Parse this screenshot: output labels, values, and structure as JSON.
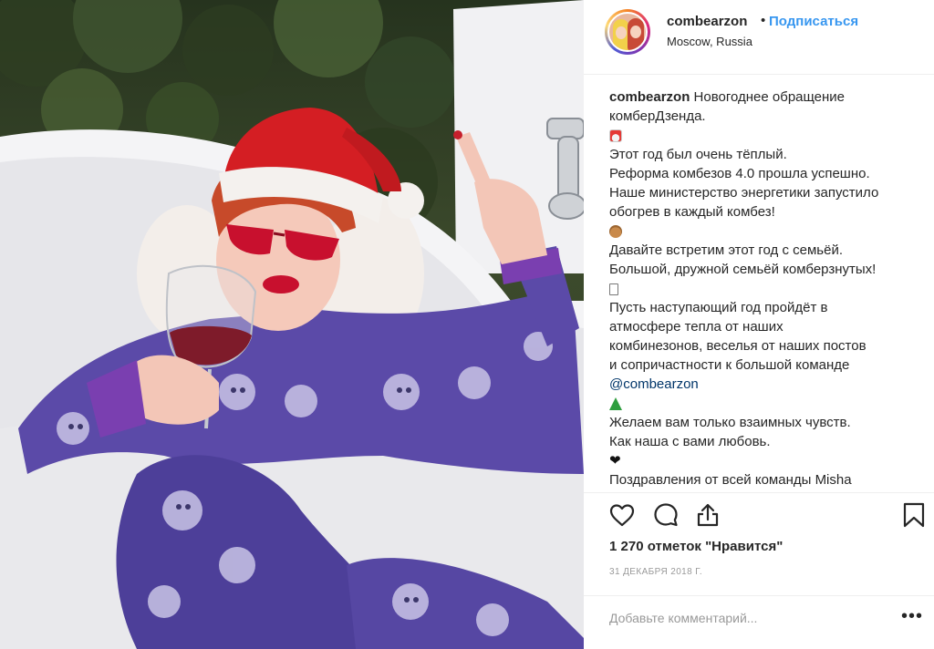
{
  "post": {
    "photo_label": "Post photo"
  },
  "header": {
    "username": "combearzon",
    "separator": "•",
    "follow_label": "Подписаться",
    "location": "Moscow, Russia"
  },
  "caption": {
    "author": "combearzon",
    "first_line_text": " Новогоднее обращение",
    "lines": [
      "комберДзенда.",
      "",
      "Этот год был очень тёплый.",
      "Реформа комбезов 4.0 прошла успешно.",
      "Наше министерство энергетики запустило",
      "обогрев в каждый комбез!",
      "",
      "Давайте встретим этот год с семьёй.",
      "Большой, дружной семьёй комберзнутых!",
      "",
      "Пусть наступающий год пройдёт в",
      "атмосфере тепла от наших",
      "комбинезонов, веселья от наших постов",
      "и сопричастности к большой команде",
      "@combearzon",
      "",
      "Желаем вам только взаимных чувств.",
      "Как наша с вами любовь.",
      "",
      "Поздравления от всей команды Misha"
    ],
    "emojis": {
      "e1": "santa-emoji",
      "e2": "bear-emoji",
      "e3": "unknown-glyph",
      "e4": "christmas-tree-emoji",
      "e5": "black-heart-emoji"
    }
  },
  "actions": {
    "like_icon": "heart-icon",
    "comment_icon": "speech-bubble-icon",
    "share_icon": "share-icon",
    "save_icon": "bookmark-icon"
  },
  "likes_text": "1 270 отметок \"Нравится\"",
  "date_text": "31 декабря 2018 г.",
  "comment": {
    "placeholder": "Добавьте комментарий...",
    "more_label": "•••"
  },
  "colors": {
    "link_blue": "#3897f0",
    "text": "#262626",
    "muted": "#999999",
    "border": "#efefef"
  }
}
